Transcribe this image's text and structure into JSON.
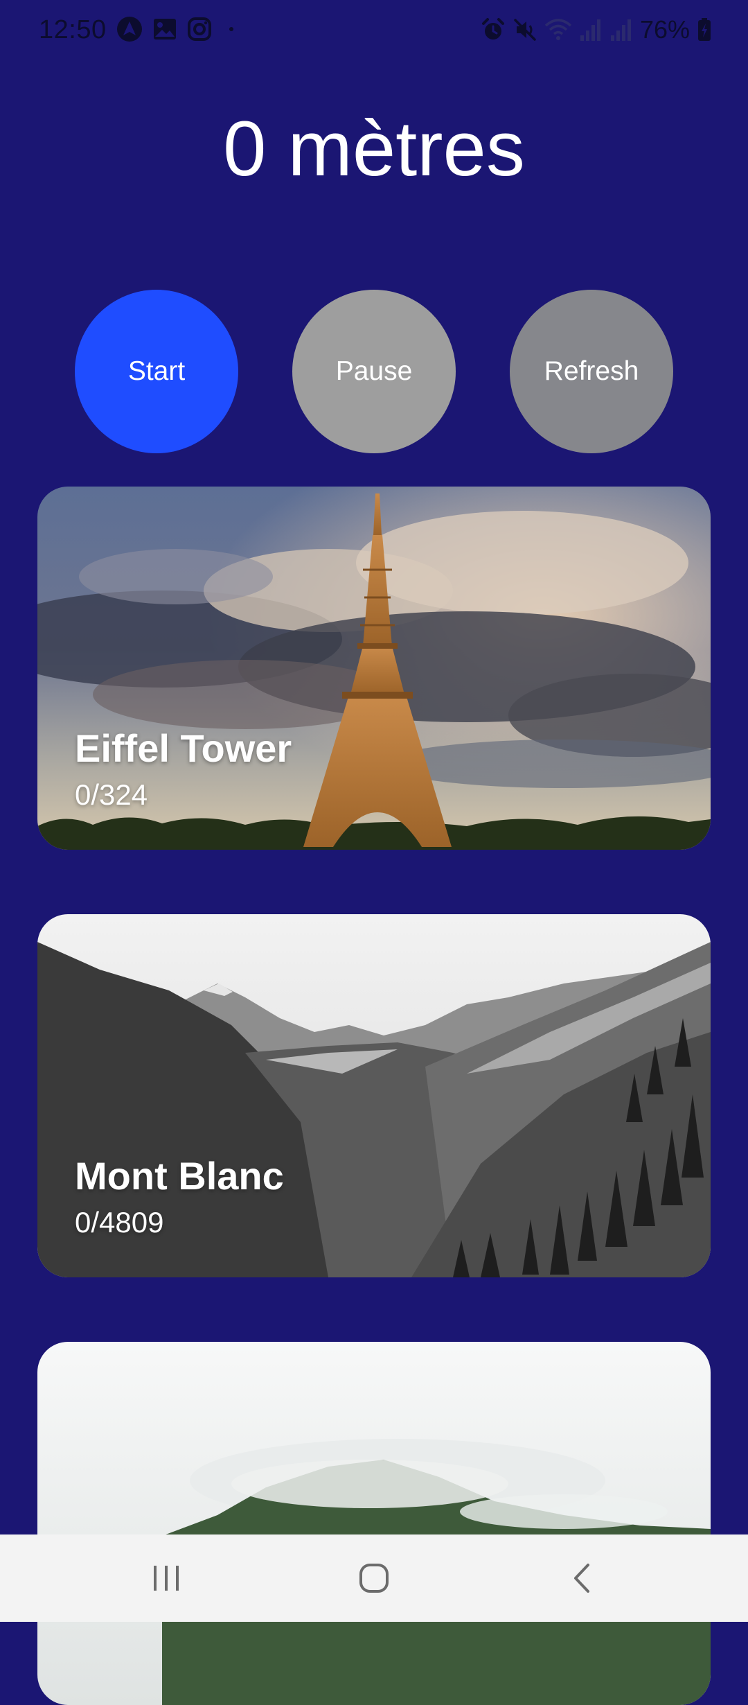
{
  "status_bar": {
    "time": "12:50",
    "battery_percent": "76%",
    "left_icons": [
      "android-auto-icon",
      "gallery-icon",
      "instagram-icon",
      "notification-dot-icon"
    ],
    "right_icons": [
      "alarm-icon",
      "mute-icon",
      "wifi-icon",
      "signal-icon",
      "signal-icon",
      "battery-charging-icon"
    ]
  },
  "distance": {
    "label": "0 mètres"
  },
  "controls": {
    "start_label": "Start",
    "pause_label": "Pause",
    "refresh_label": "Refresh"
  },
  "landmarks": [
    {
      "name": "Eiffel Tower",
      "progress": "0/324"
    },
    {
      "name": "Mont Blanc",
      "progress": "0/4809"
    },
    {
      "name": "",
      "progress": ""
    }
  ],
  "colors": {
    "background": "#1b1673",
    "start_button": "#1f4dff",
    "pause_button": "#9e9e9e",
    "refresh_button": "#86878c",
    "nav_bar": "#f3f3f3"
  },
  "nav_bar": {
    "icons": [
      "recent-apps-icon",
      "home-icon",
      "back-icon"
    ]
  }
}
